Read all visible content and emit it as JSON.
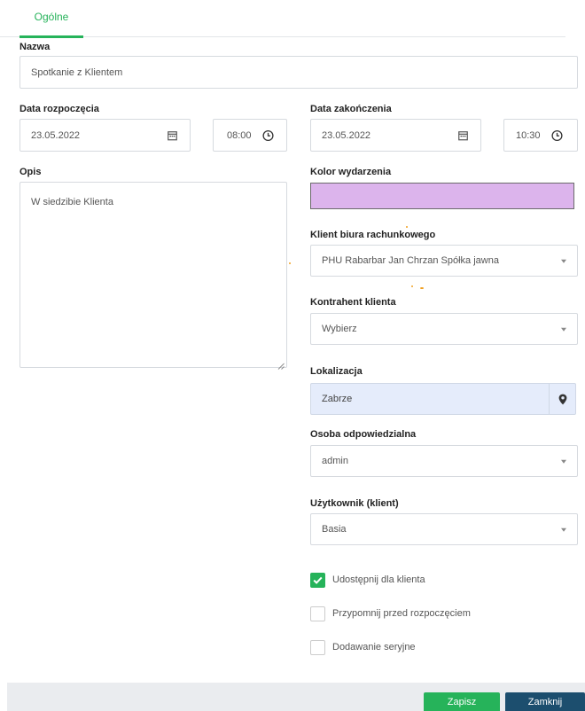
{
  "tabs": [
    {
      "label": "Ogólne",
      "active": true
    }
  ],
  "form": {
    "name": {
      "label": "Nazwa",
      "value": "Spotkanie z Klientem"
    },
    "start": {
      "label": "Data rozpoczęcia",
      "date": "23.05.2022",
      "time": "08:00"
    },
    "end": {
      "label": "Data zakończenia",
      "date": "23.05.2022",
      "time": "10:30"
    },
    "description": {
      "label": "Opis",
      "value": "W siedzibie Klienta"
    },
    "event_color": {
      "label": "Kolor wydarzenia",
      "value": "#dcb4ec"
    },
    "office_client": {
      "label": "Klient biura rachunkowego",
      "value": "PHU Rabarbar Jan Chrzan Spółka jawna"
    },
    "contractor": {
      "label": "Kontrahent klienta",
      "value": "Wybierz"
    },
    "location": {
      "label": "Lokalizacja",
      "value": "Zabrze"
    },
    "responsible": {
      "label": "Osoba odpowiedzialna",
      "value": "admin"
    },
    "user": {
      "label": "Użytkownik (klient)",
      "value": "Basia"
    },
    "checkboxes": [
      {
        "label": "Udostępnij dla klienta",
        "checked": true
      },
      {
        "label": "Przypomnij przed rozpoczęciem",
        "checked": false
      },
      {
        "label": "Dodawanie seryjne",
        "checked": false
      }
    ]
  },
  "footer": {
    "save_label": "Zapisz",
    "close_label": "Zamknij"
  },
  "icons": [
    "calendar-icon",
    "clock-icon",
    "map-pin-icon",
    "chevron-down-icon",
    "checkmark-icon",
    "resize-handle-icon"
  ],
  "colors": {
    "accent": "#26b35a",
    "primary_dark": "#1c4e6e",
    "location_bg": "#e5ecfb",
    "event_color": "#dcb4ec"
  }
}
